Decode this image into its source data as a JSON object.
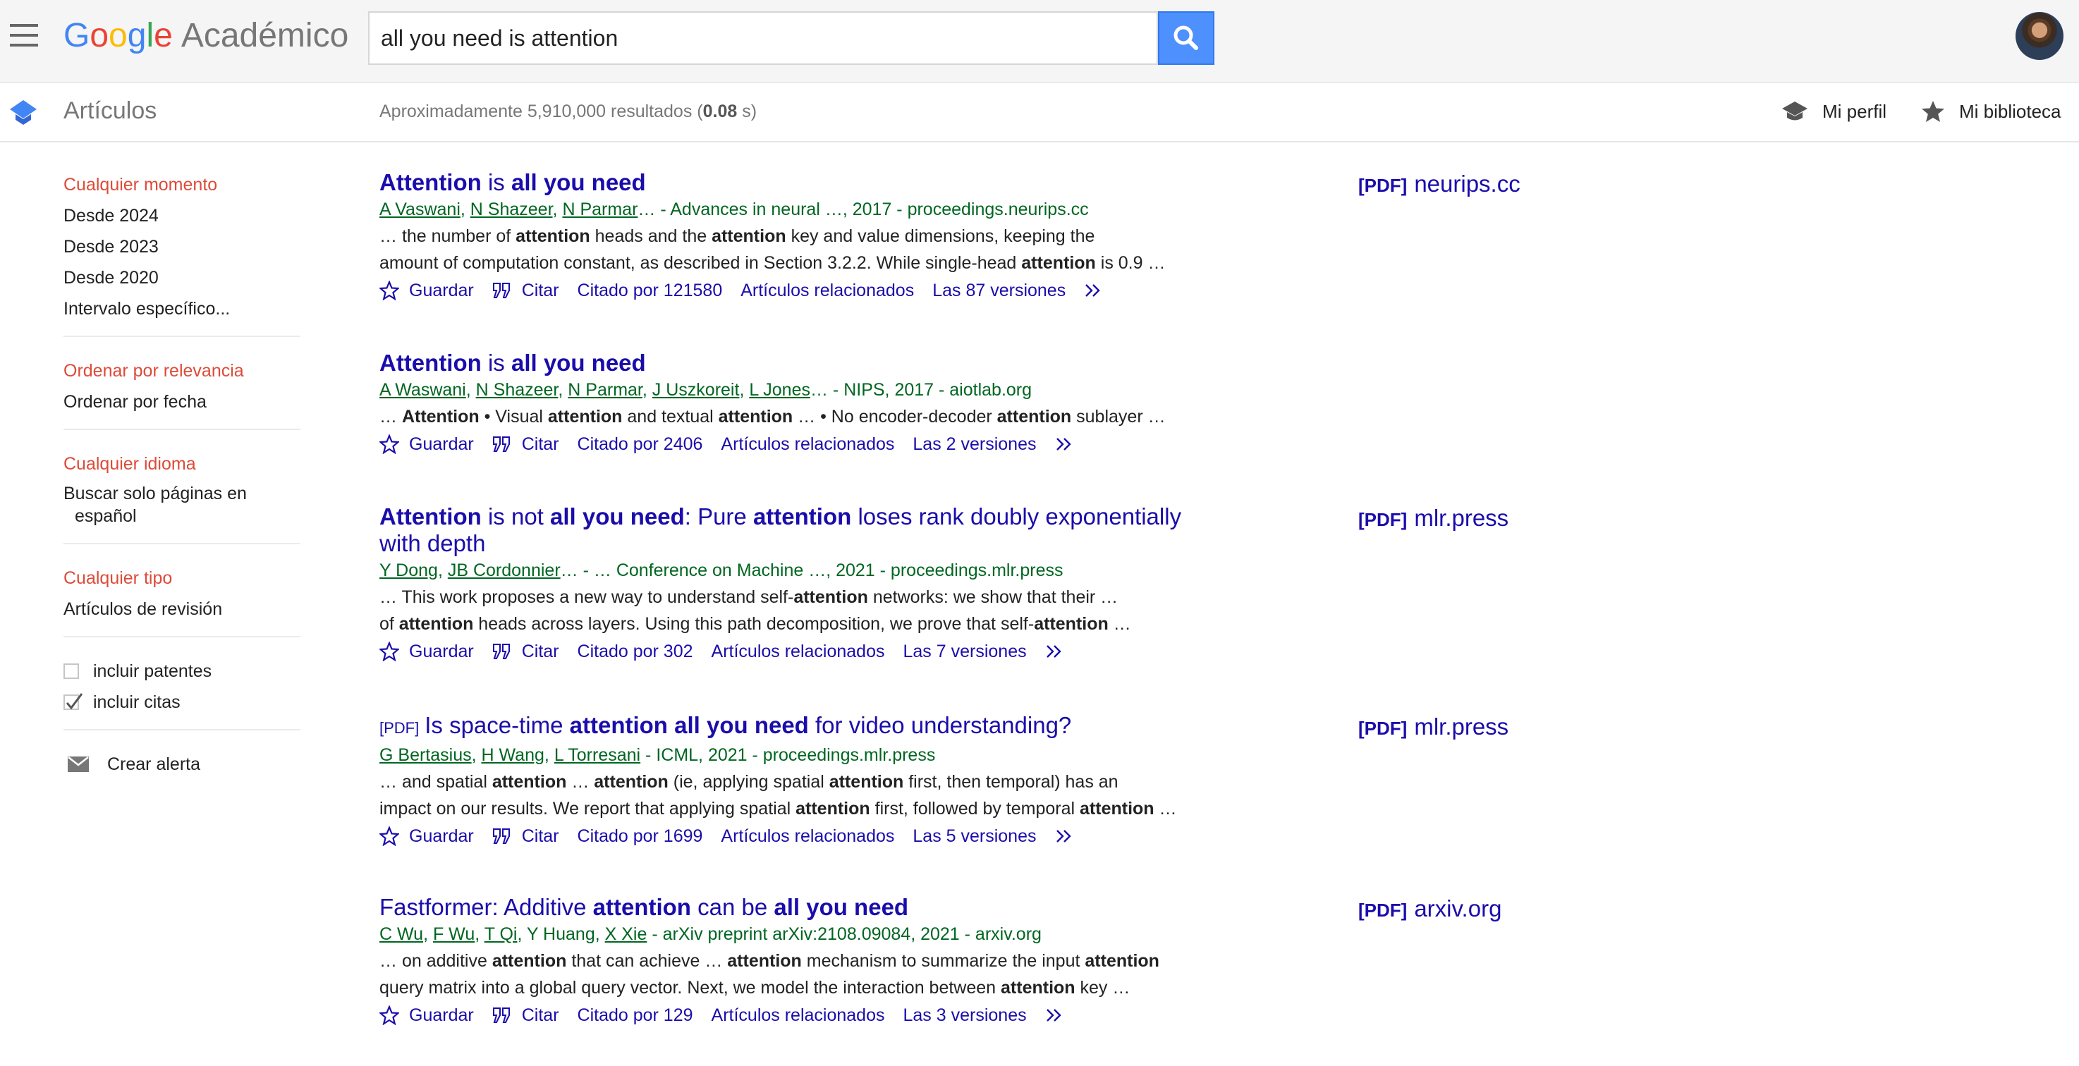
{
  "header": {
    "logo_google": [
      "G",
      "o",
      "o",
      "g",
      "l",
      "e"
    ],
    "logo_app": "Académico",
    "search": {
      "value": "all you need is attention"
    }
  },
  "subbar": {
    "section_title": "Artículos",
    "stats_prefix": "Aproximadamente 5,910,000 resultados (",
    "stats_time": "0.08",
    "stats_suffix": " s)",
    "my_profile": "Mi perfil",
    "my_library": "Mi biblioteca"
  },
  "sidebar": {
    "time": [
      "Cualquier momento",
      "Desde 2024",
      "Desde 2023",
      "Desde 2020",
      "Intervalo específico..."
    ],
    "sort": [
      "Ordenar por relevancia",
      "Ordenar por fecha"
    ],
    "language": [
      "Cualquier idioma",
      "Buscar solo páginas en",
      "español"
    ],
    "type": [
      "Cualquier tipo",
      "Artículos de revisión"
    ],
    "include_patents": "incluir patentes",
    "include_citations": "incluir citas",
    "include_patents_checked": false,
    "include_citations_checked": true,
    "create_alert": "Crear alerta"
  },
  "actions": {
    "save": "Guardar",
    "cite": "Citar",
    "related": "Artículos relacionados"
  },
  "results": [
    {
      "title": [
        {
          "t": "Attention",
          "b": true
        },
        {
          "t": " is ",
          "b": false
        },
        {
          "t": "all you need",
          "b": true
        }
      ],
      "authors": [
        {
          "t": "A Vaswani",
          "link": true
        },
        {
          "t": ", ",
          "link": false
        },
        {
          "t": "N Shazeer",
          "link": true
        },
        {
          "t": ", ",
          "link": false
        },
        {
          "t": "N Parmar",
          "link": true
        },
        {
          "t": "… - Advances in neural …, 2017 - proceedings.neurips.cc",
          "link": false
        }
      ],
      "snippet": [
        [
          {
            "t": "… the number of ",
            "b": false
          },
          {
            "t": "attention",
            "b": true
          },
          {
            "t": " heads and the ",
            "b": false
          },
          {
            "t": "attention",
            "b": true
          },
          {
            "t": " key and value dimensions, keeping the",
            "b": false
          }
        ],
        [
          {
            "t": "amount of computation constant, as described in Section 3.2.2. While single-head ",
            "b": false
          },
          {
            "t": "attention",
            "b": true
          },
          {
            "t": " is 0.9 …",
            "b": false
          }
        ]
      ],
      "cited_by": "Citado por 121580",
      "versions": "Las 87 versiones",
      "side_pdf": "[PDF]",
      "side_domain": "neurips.cc"
    },
    {
      "title": [
        {
          "t": "Attention",
          "b": true
        },
        {
          "t": " is ",
          "b": false
        },
        {
          "t": "all you need",
          "b": true
        }
      ],
      "authors": [
        {
          "t": "A Waswani",
          "link": true
        },
        {
          "t": ", ",
          "link": false
        },
        {
          "t": "N Shazeer",
          "link": true
        },
        {
          "t": ", ",
          "link": false
        },
        {
          "t": "N Parmar",
          "link": true
        },
        {
          "t": ", ",
          "link": false
        },
        {
          "t": "J Uszkoreit",
          "link": true
        },
        {
          "t": ", ",
          "link": false
        },
        {
          "t": "L Jones",
          "link": true
        },
        {
          "t": "… - NIPS, 2017 - aiotlab.org",
          "link": false
        }
      ],
      "snippet": [
        [
          {
            "t": "… ",
            "b": false
          },
          {
            "t": "Attention",
            "b": true
          },
          {
            "t": " • Visual ",
            "b": false
          },
          {
            "t": "attention",
            "b": true
          },
          {
            "t": " and textual ",
            "b": false
          },
          {
            "t": "attention",
            "b": true
          },
          {
            "t": " … • No encoder-decoder ",
            "b": false
          },
          {
            "t": "attention",
            "b": true
          },
          {
            "t": " sublayer …",
            "b": false
          }
        ]
      ],
      "cited_by": "Citado por 2406",
      "versions": "Las 2 versiones"
    },
    {
      "title": [
        {
          "t": "Attention",
          "b": true
        },
        {
          "t": " is not ",
          "b": false
        },
        {
          "t": "all you need",
          "b": true
        },
        {
          "t": ": Pure ",
          "b": false
        },
        {
          "t": "attention",
          "b": true
        },
        {
          "t": " loses rank doubly exponentially with depth",
          "b": false
        }
      ],
      "authors": [
        {
          "t": "Y Dong",
          "link": true
        },
        {
          "t": ", ",
          "link": false
        },
        {
          "t": "JB Cordonnier",
          "link": true
        },
        {
          "t": "… - … Conference on Machine …, 2021 - proceedings.mlr.press",
          "link": false
        }
      ],
      "snippet": [
        [
          {
            "t": "… This work proposes a new way to understand self-",
            "b": false
          },
          {
            "t": "attention",
            "b": true
          },
          {
            "t": " networks: we show that their …",
            "b": false
          }
        ],
        [
          {
            "t": "of ",
            "b": false
          },
          {
            "t": "attention",
            "b": true
          },
          {
            "t": " heads across layers. Using this path decomposition, we prove that self-",
            "b": false
          },
          {
            "t": "attention",
            "b": true
          },
          {
            "t": " …",
            "b": false
          }
        ]
      ],
      "cited_by": "Citado por 302",
      "versions": "Las 7 versiones",
      "side_pdf": "[PDF]",
      "side_domain": "mlr.press"
    },
    {
      "pdf_tag": "[PDF]",
      "title": [
        {
          "t": "Is space-time ",
          "b": false
        },
        {
          "t": "attention all you need",
          "b": true
        },
        {
          "t": " for video understanding?",
          "b": false
        }
      ],
      "authors": [
        {
          "t": "G Bertasius",
          "link": true
        },
        {
          "t": ", ",
          "link": false
        },
        {
          "t": "H Wang",
          "link": true
        },
        {
          "t": ", ",
          "link": false
        },
        {
          "t": "L Torresani",
          "link": true
        },
        {
          "t": " - ICML, 2021 - proceedings.mlr.press",
          "link": false
        }
      ],
      "snippet": [
        [
          {
            "t": "… and spatial ",
            "b": false
          },
          {
            "t": "attention",
            "b": true
          },
          {
            "t": " … ",
            "b": false
          },
          {
            "t": "attention",
            "b": true
          },
          {
            "t": " (ie, applying spatial ",
            "b": false
          },
          {
            "t": "attention",
            "b": true
          },
          {
            "t": " first, then temporal) has an",
            "b": false
          }
        ],
        [
          {
            "t": "impact on our results. We report that applying spatial ",
            "b": false
          },
          {
            "t": "attention",
            "b": true
          },
          {
            "t": " first, followed by temporal ",
            "b": false
          },
          {
            "t": "attention",
            "b": true
          },
          {
            "t": " …",
            "b": false
          }
        ]
      ],
      "cited_by": "Citado por 1699",
      "versions": "Las 5 versiones",
      "side_pdf": "[PDF]",
      "side_domain": "mlr.press"
    },
    {
      "title": [
        {
          "t": "Fastformer: Additive ",
          "b": false
        },
        {
          "t": "attention",
          "b": true
        },
        {
          "t": " can be ",
          "b": false
        },
        {
          "t": "all you need",
          "b": true
        }
      ],
      "authors": [
        {
          "t": "C Wu",
          "link": true
        },
        {
          "t": ", ",
          "link": false
        },
        {
          "t": "F Wu",
          "link": true
        },
        {
          "t": ", ",
          "link": false
        },
        {
          "t": "T Qi",
          "link": true
        },
        {
          "t": ", Y Huang, ",
          "link": false
        },
        {
          "t": "X Xie",
          "link": true
        },
        {
          "t": " - arXiv preprint arXiv:2108.09084, 2021 - arxiv.org",
          "link": false
        }
      ],
      "snippet": [
        [
          {
            "t": "… on additive ",
            "b": false
          },
          {
            "t": "attention",
            "b": true
          },
          {
            "t": " that can achieve … ",
            "b": false
          },
          {
            "t": "attention",
            "b": true
          },
          {
            "t": " mechanism to summarize the input ",
            "b": false
          },
          {
            "t": "attention",
            "b": true
          }
        ],
        [
          {
            "t": "query matrix into a global query vector. Next, we model the interaction between ",
            "b": false
          },
          {
            "t": "attention",
            "b": true
          },
          {
            "t": " key …",
            "b": false
          }
        ]
      ],
      "cited_by": "Citado por 129",
      "versions": "Las 3 versiones",
      "side_pdf": "[PDF]",
      "side_domain": "arxiv.org"
    }
  ]
}
